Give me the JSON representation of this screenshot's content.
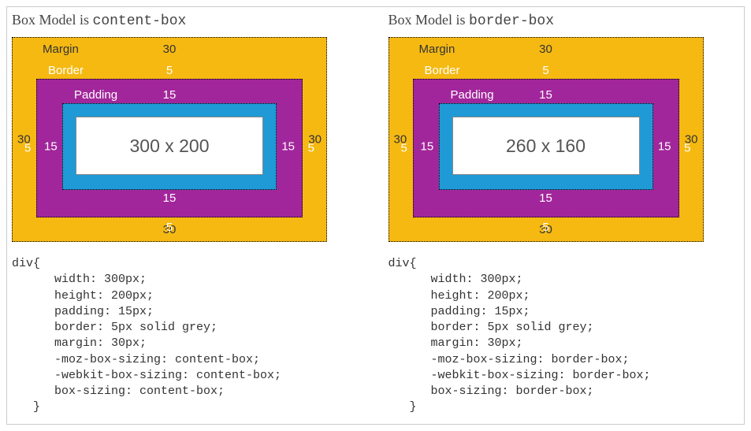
{
  "left": {
    "title_prefix": "Box Model is ",
    "title_mode": "content-box",
    "diagram": {
      "margin_label": "Margin",
      "margin_value": "30",
      "border_label": "Border",
      "border_value": "5",
      "padding_label": "Padding",
      "padding_value": "15",
      "content_size": "300 x 200"
    },
    "code": "div{\n      width: 300px;\n      height: 200px;\n      padding: 15px;\n      border: 5px solid grey;\n      margin: 30px;\n      -moz-box-sizing: content-box;\n      -webkit-box-sizing: content-box;\n      box-sizing: content-box;\n   }"
  },
  "right": {
    "title_prefix": "Box Model is ",
    "title_mode": "border-box",
    "diagram": {
      "margin_label": "Margin",
      "margin_value": "30",
      "border_label": "Border",
      "border_value": "5",
      "padding_label": "Padding",
      "padding_value": "15",
      "content_size": "260 x 160"
    },
    "code": "div{\n      width: 300px;\n      height: 200px;\n      padding: 15px;\n      border: 5px solid grey;\n      margin: 30px;\n      -moz-box-sizing: border-box;\n      -webkit-box-sizing: border-box;\n      box-sizing: border-box;\n   }"
  },
  "colors": {
    "margin": "#f5b912",
    "border": "#a2269b",
    "padding": "#1f9ad6",
    "content": "#ffffff"
  }
}
